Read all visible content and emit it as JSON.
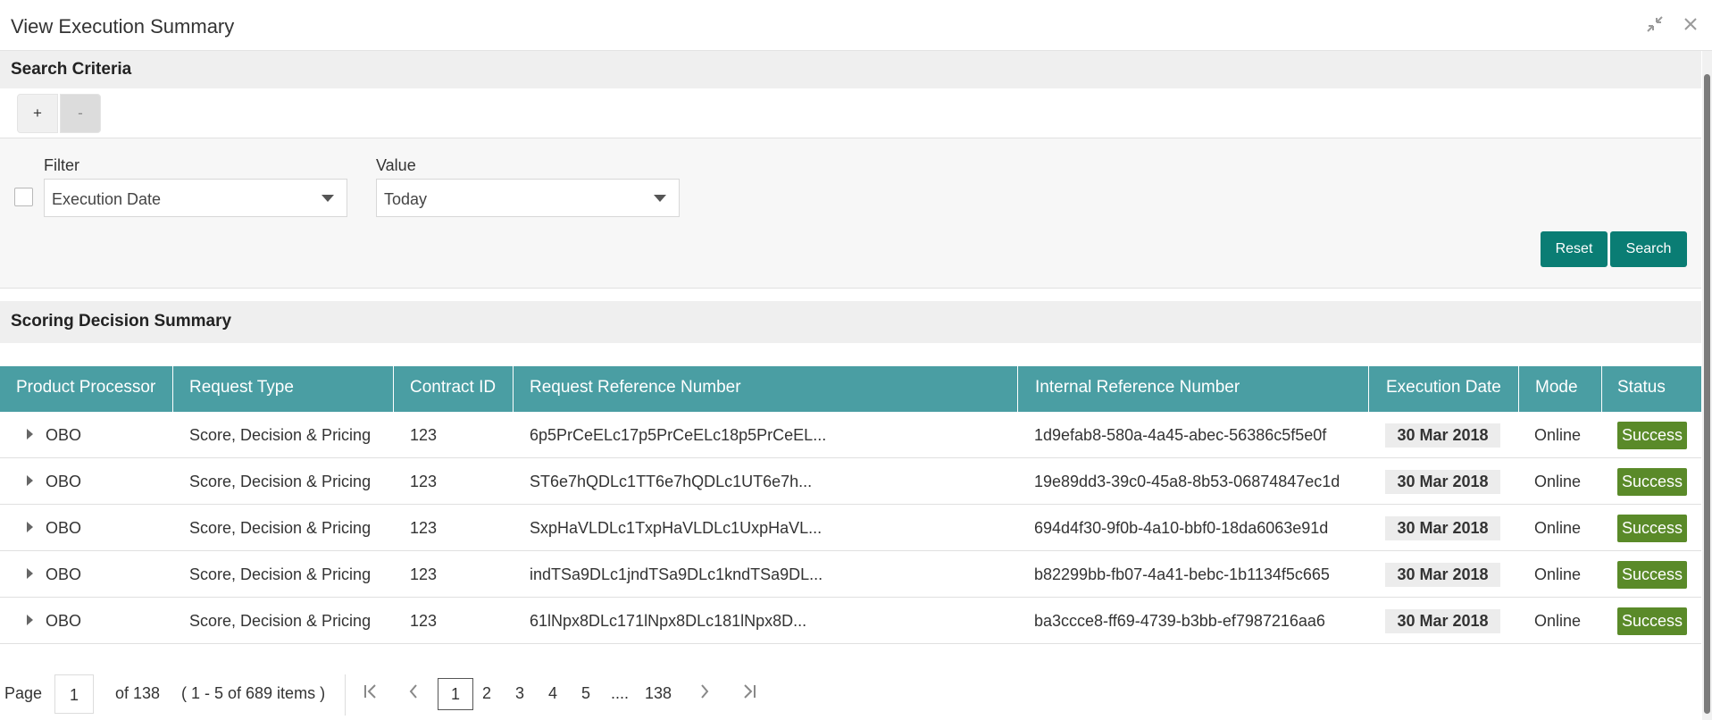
{
  "window": {
    "title": "View Execution Summary",
    "minimize_icon": "collapse-arrows-icon",
    "close_icon": "close-icon"
  },
  "search_criteria": {
    "heading": "Search Criteria",
    "add_label": "+",
    "remove_label": "-",
    "filter_label": "Filter",
    "filter_value": "Execution Date",
    "value_label": "Value",
    "value_value": "Today",
    "reset_label": "Reset",
    "search_label": "Search"
  },
  "summary": {
    "heading": "Scoring Decision Summary",
    "columns": [
      "Product Processor",
      "Request Type",
      "Contract ID",
      "Request Reference Number",
      "Internal Reference Number",
      "Execution Date",
      "Mode",
      "Status"
    ],
    "rows": [
      {
        "product_processor": "OBO",
        "request_type": "Score, Decision & Pricing",
        "contract_id": "123",
        "request_ref": "6p5PrCeELc17p5PrCeELc18p5PrCeEL...",
        "internal_ref": "1d9efab8-580a-4a45-abec-56386c5f5e0f",
        "execution_date": "30 Mar 2018",
        "mode": "Online",
        "status": "Success"
      },
      {
        "product_processor": "OBO",
        "request_type": "Score, Decision & Pricing",
        "contract_id": "123",
        "request_ref": "ST6e7hQDLc1TT6e7hQDLc1UT6e7h...",
        "internal_ref": "19e89dd3-39c0-45a8-8b53-06874847ec1d",
        "execution_date": "30 Mar 2018",
        "mode": "Online",
        "status": "Success"
      },
      {
        "product_processor": "OBO",
        "request_type": "Score, Decision & Pricing",
        "contract_id": "123",
        "request_ref": "SxpHaVLDLc1TxpHaVLDLc1UxpHaVL...",
        "internal_ref": "694d4f30-9f0b-4a10-bbf0-18da6063e91d",
        "execution_date": "30 Mar 2018",
        "mode": "Online",
        "status": "Success"
      },
      {
        "product_processor": "OBO",
        "request_type": "Score, Decision & Pricing",
        "contract_id": "123",
        "request_ref": "indTSa9DLc1jndTSa9DLc1kndTSa9DL...",
        "internal_ref": "b82299bb-fb07-4a41-bebc-1b1134f5c665",
        "execution_date": "30 Mar 2018",
        "mode": "Online",
        "status": "Success"
      },
      {
        "product_processor": "OBO",
        "request_type": "Score, Decision & Pricing",
        "contract_id": "123",
        "request_ref": "61lNpx8DLc171lNpx8DLc181lNpx8D...",
        "internal_ref": "ba3ccce8-ff69-4739-b3bb-ef7987216aa6",
        "execution_date": "30 Mar 2018",
        "mode": "Online",
        "status": "Success"
      }
    ]
  },
  "pagination": {
    "page_label": "Page",
    "current_page": "1",
    "of_total": "of 138",
    "range": "( 1 - 5 of 689 items )",
    "pages": [
      "1",
      "2",
      "3",
      "4",
      "5",
      "....",
      "138"
    ],
    "first_icon": "first-page-icon",
    "prev_icon": "prev-page-icon",
    "next_icon": "next-page-icon",
    "last_icon": "last-page-icon"
  },
  "colors": {
    "accent": "#0a7d74",
    "table_header": "#4a9ea3",
    "success": "#5a8a29"
  }
}
